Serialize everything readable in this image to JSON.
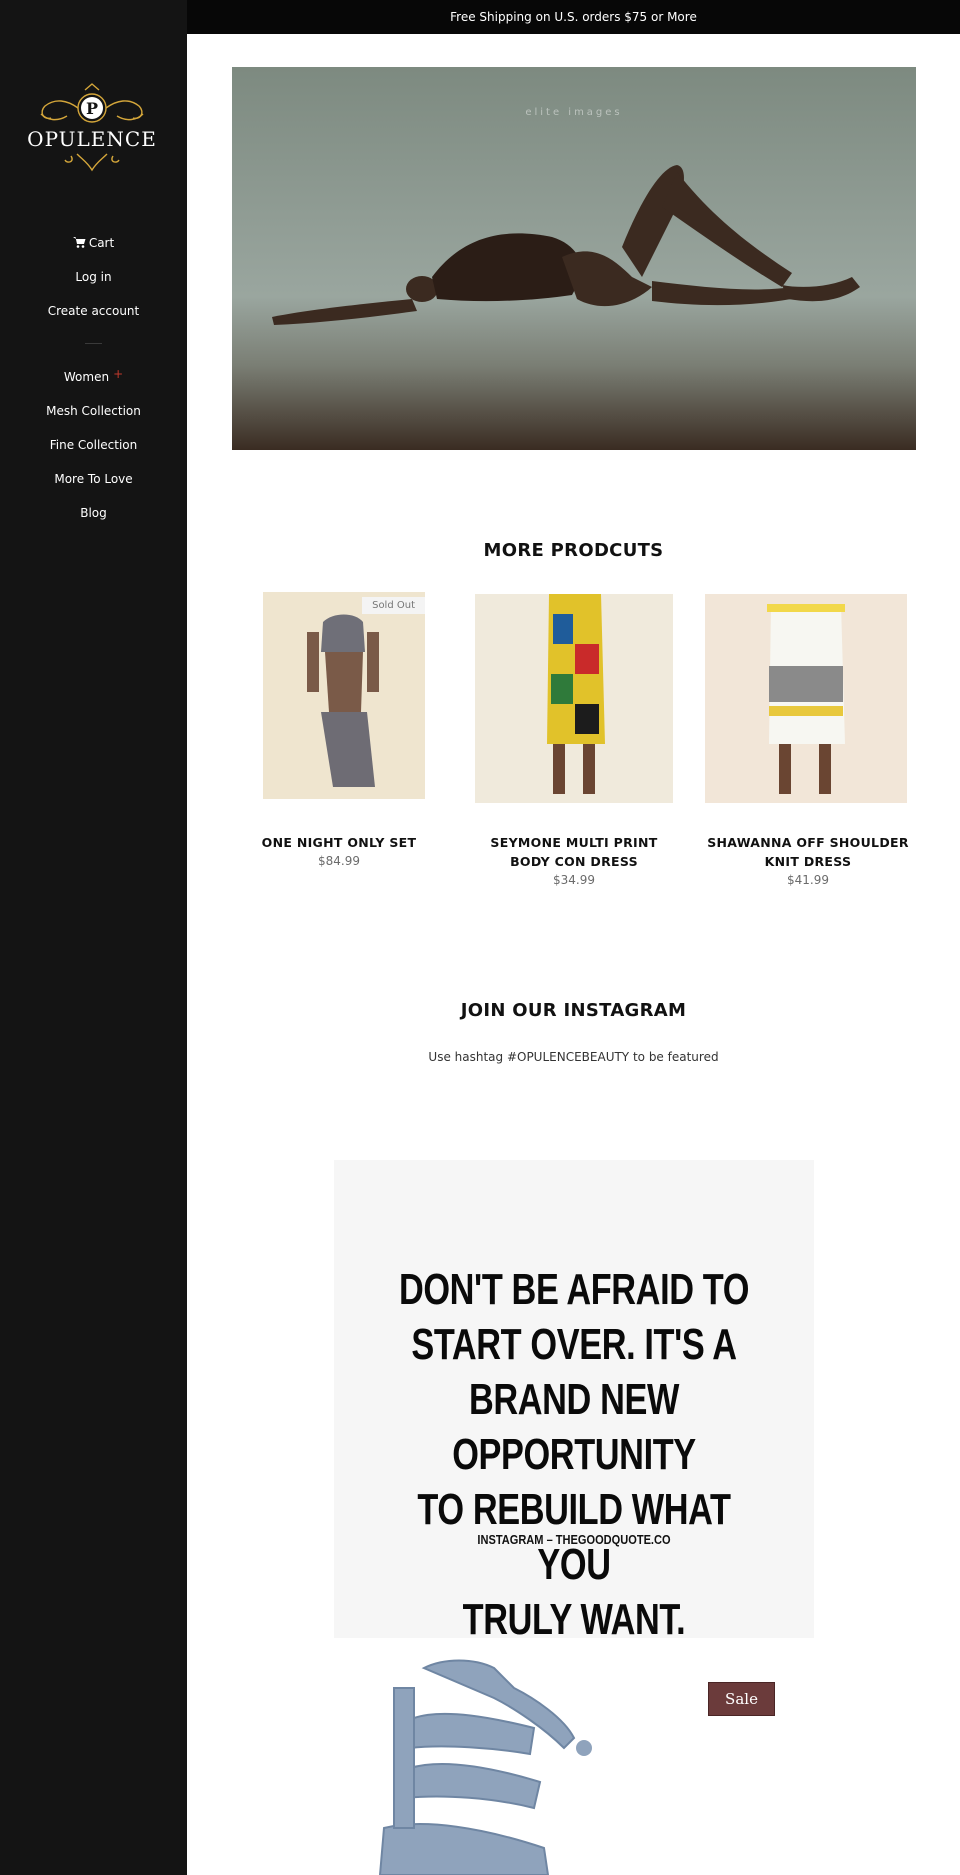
{
  "announcement": "Free Shipping on U.S. orders $75 or More",
  "brand": {
    "name": "OPULENCE",
    "monogram": "P",
    "accent": "#d4a63a"
  },
  "nav_top": [
    {
      "label": "Cart",
      "icon": "cart-icon"
    },
    {
      "label": "Log in"
    },
    {
      "label": "Create account"
    }
  ],
  "nav_main": [
    {
      "label": "Women",
      "expand": "+"
    },
    {
      "label": "Mesh Collection"
    },
    {
      "label": "Fine Collection"
    },
    {
      "label": "More To Love"
    },
    {
      "label": "Blog"
    }
  ],
  "hero": {
    "watermark": "elite images"
  },
  "products_section": {
    "title": "MORE PRODCUTS",
    "items": [
      {
        "name": "ONE NIGHT ONLY SET",
        "price": "$84.99",
        "badge": "Sold Out"
      },
      {
        "name": "SEYMONE MULTI PRINT BODY CON DRESS",
        "price": "$34.99"
      },
      {
        "name": "SHAWANNA OFF SHOULDER KNIT DRESS",
        "price": "$41.99"
      }
    ]
  },
  "instagram": {
    "title": "JOIN OUR INSTAGRAM",
    "subtitle": "Use hashtag #OPULENCEBEAUTY to be featured",
    "quote_lines": [
      "DON'T BE AFRAID TO",
      "START OVER. IT'S A",
      "BRAND NEW OPPORTUNITY",
      "TO REBUILD WHAT YOU",
      "TRULY WANT."
    ],
    "quote_credit": "INSTAGRAM – THEGOODQUOTE.CO",
    "sale_badge": "Sale"
  },
  "colors": {
    "sidebar": "#141414",
    "announce": "#070707",
    "sale": "#6b3b3b"
  }
}
